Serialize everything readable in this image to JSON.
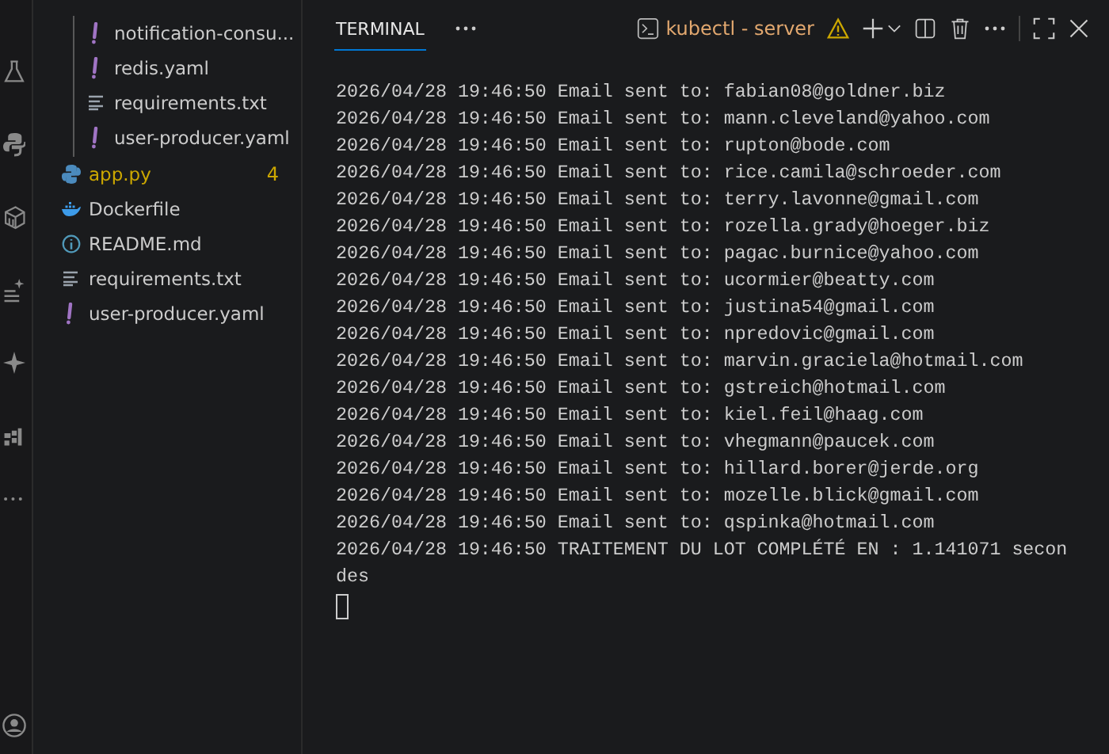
{
  "explorer": {
    "nested_items": [
      {
        "name": "notification-consu...",
        "kind": "yaml"
      },
      {
        "name": "redis.yaml",
        "kind": "yaml"
      },
      {
        "name": "requirements.txt",
        "kind": "text"
      },
      {
        "name": "user-producer.yaml",
        "kind": "yaml"
      }
    ],
    "items": [
      {
        "name": "app.py",
        "kind": "python",
        "badge": "4"
      },
      {
        "name": "Dockerfile",
        "kind": "docker"
      },
      {
        "name": "README.md",
        "kind": "info"
      },
      {
        "name": "requirements.txt",
        "kind": "text"
      },
      {
        "name": "user-producer.yaml",
        "kind": "yaml"
      }
    ]
  },
  "panel": {
    "tabs": [
      {
        "label": "TERMINAL",
        "selected": true
      }
    ],
    "terminal_name": "kubectl - server",
    "output": [
      "2026/04/28 19:46:50 Email sent to: fabian08@goldner.biz",
      "2026/04/28 19:46:50 Email sent to: mann.cleveland@yahoo.com",
      "2026/04/28 19:46:50 Email sent to: rupton@bode.com",
      "2026/04/28 19:46:50 Email sent to: rice.camila@schroeder.com",
      "2026/04/28 19:46:50 Email sent to: terry.lavonne@gmail.com",
      "2026/04/28 19:46:50 Email sent to: rozella.grady@hoeger.biz",
      "2026/04/28 19:46:50 Email sent to: pagac.burnice@yahoo.com",
      "2026/04/28 19:46:50 Email sent to: ucormier@beatty.com",
      "2026/04/28 19:46:50 Email sent to: justina54@gmail.com",
      "2026/04/28 19:46:50 Email sent to: npredovic@gmail.com",
      "2026/04/28 19:46:50 Email sent to: marvin.graciela@hotmail.com",
      "2026/04/28 19:46:50 Email sent to: gstreich@hotmail.com",
      "2026/04/28 19:46:50 Email sent to: kiel.feil@haag.com",
      "2026/04/28 19:46:50 Email sent to: vhegmann@paucek.com",
      "2026/04/28 19:46:50 Email sent to: hillard.borer@jerde.org",
      "2026/04/28 19:46:50 Email sent to: mozelle.blick@gmail.com",
      "2026/04/28 19:46:50 Email sent to: qspinka@hotmail.com",
      "2026/04/28 19:46:50 TRAITEMENT DU LOT COMPLÉTÉ EN : 1.141071 secondes"
    ]
  }
}
